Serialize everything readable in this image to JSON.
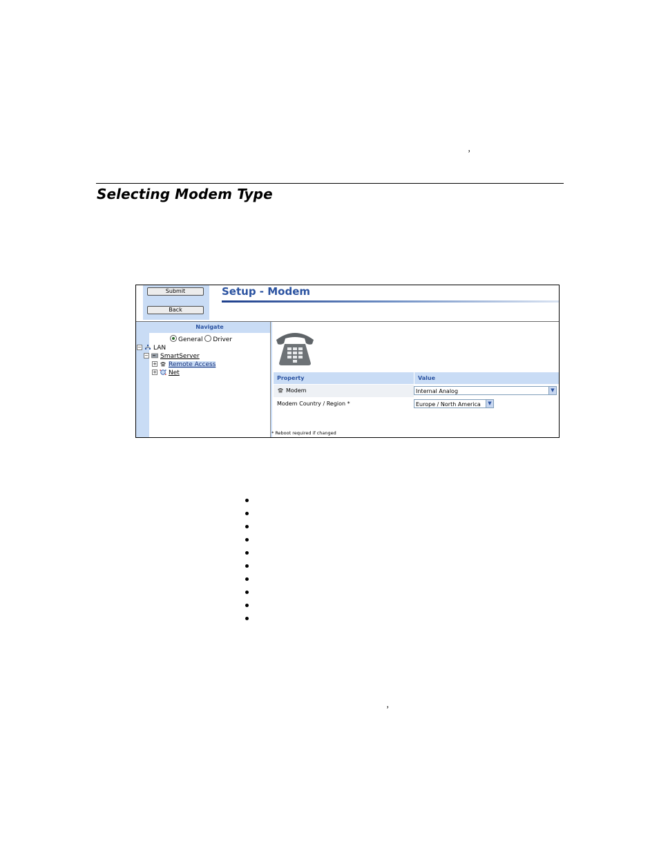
{
  "document": {
    "stray_comma_top": "’",
    "section_title": "Selecting Modem Type",
    "stray_comma_bottom": "’",
    "bullet_count": 10
  },
  "screenshot": {
    "buttons": {
      "submit_label": "Submit",
      "back_label": "Back"
    },
    "page_heading": "Setup - Modem",
    "navigate": {
      "header": "Navigate",
      "radio_general": "General",
      "radio_driver": "Driver",
      "selected_radio": "General",
      "tree": {
        "lan": "LAN",
        "smartserver": "SmartServer",
        "remote_access": "Remote Access",
        "net": "Net"
      }
    },
    "table": {
      "col_property": "Property",
      "col_value": "Value",
      "rows": [
        {
          "property": "Modem",
          "value": "Internal Analog"
        },
        {
          "property": "Modem Country / Region *",
          "value": "Europe / North America"
        }
      ]
    },
    "footnote": "* Reboot required if changed",
    "colors": {
      "accent": "#2a52a0",
      "panel": "#c9dcf5"
    },
    "icons": [
      "phone-icon",
      "network-icon",
      "server-icon",
      "globe-icon",
      "chevron-down-icon"
    ]
  }
}
